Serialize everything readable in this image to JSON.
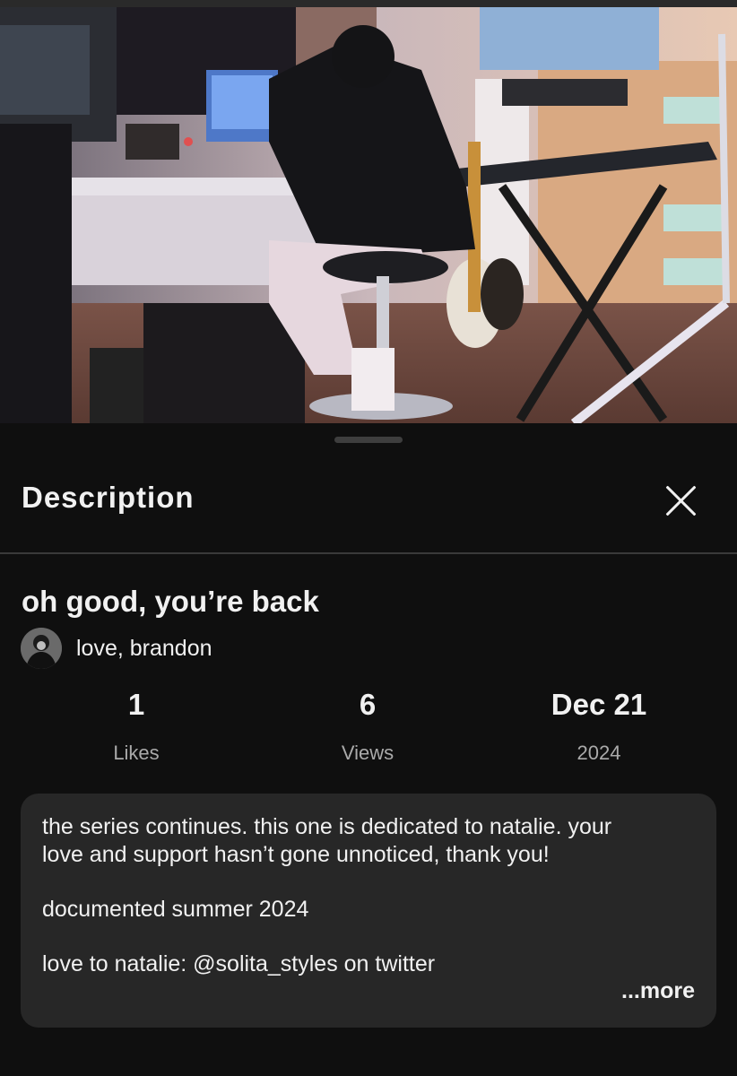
{
  "video": {
    "thumbnail_description": "studio-room"
  },
  "sheet": {
    "title": "Description",
    "close_icon": "close-icon"
  },
  "details": {
    "video_title": "oh good, you’re back",
    "channel_name": "love, brandon"
  },
  "stats": [
    {
      "value": "1",
      "label": "Likes"
    },
    {
      "value": "6",
      "label": "Views"
    },
    {
      "value": "Dec 21",
      "label": "2024"
    }
  ],
  "description": {
    "line1": "the series continues. this one is dedicated to natalie. your",
    "line2": "love and support hasn’t gone unnoticed, thank you!",
    "line3": "documented summer 2024",
    "line4": "love to natalie: @solita_styles on twitter",
    "more_label": "...more"
  },
  "colors": {
    "background": "#0f0f0f",
    "card": "#272727",
    "text": "#f1f1f1",
    "muted": "#aaaaaa"
  }
}
